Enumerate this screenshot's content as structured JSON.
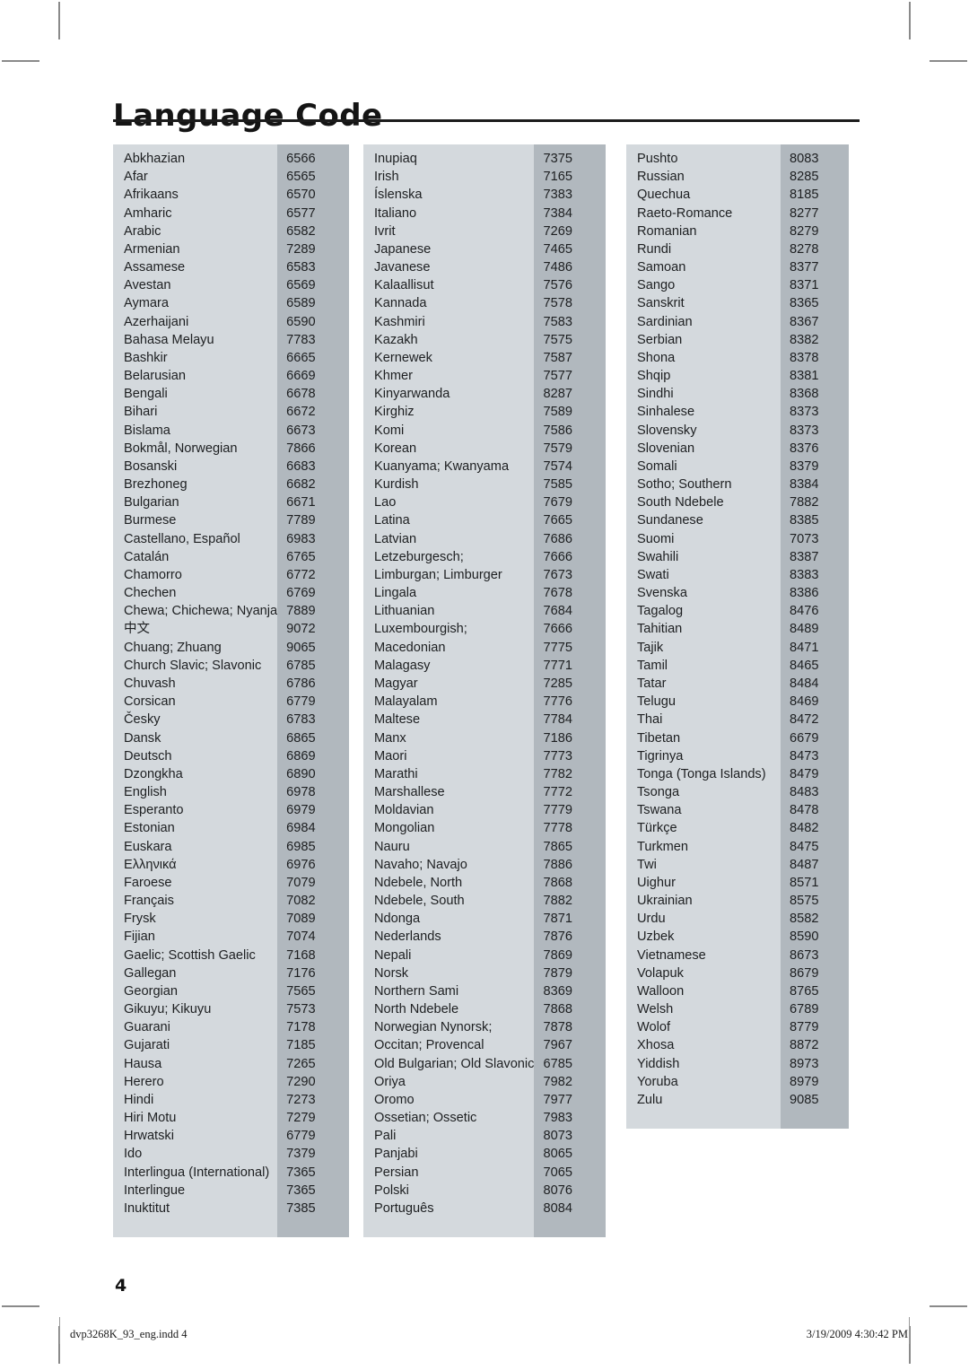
{
  "page": {
    "title": "Language Code",
    "page_number": "4"
  },
  "footer": {
    "file_name": "dvp3268K_93_eng.indd   4",
    "timestamp": "3/19/2009   4:30:42 PM"
  },
  "colors": {
    "name_band": "#d4d9dd",
    "code_band": "#b1b8be",
    "rule": "#1c1c1c",
    "text": "#1d1f21"
  },
  "columns": [
    {
      "id": "column-1",
      "rows": [
        {
          "name": "Abkhazian",
          "code": "6566"
        },
        {
          "name": "Afar",
          "code": "6565"
        },
        {
          "name": "Afrikaans",
          "code": "6570"
        },
        {
          "name": "Amharic",
          "code": "6577"
        },
        {
          "name": "Arabic",
          "code": "6582"
        },
        {
          "name": "Armenian",
          "code": "7289"
        },
        {
          "name": "Assamese",
          "code": "6583"
        },
        {
          "name": "Avestan",
          "code": "6569"
        },
        {
          "name": "Aymara",
          "code": "6589"
        },
        {
          "name": "Azerhaijani",
          "code": "6590"
        },
        {
          "name": "Bahasa Melayu",
          "code": "7783"
        },
        {
          "name": "Bashkir",
          "code": "6665"
        },
        {
          "name": "Belarusian",
          "code": "6669"
        },
        {
          "name": "Bengali",
          "code": "6678"
        },
        {
          "name": "Bihari",
          "code": "6672"
        },
        {
          "name": "Bislama",
          "code": "6673"
        },
        {
          "name": "Bokmål, Norwegian",
          "code": "7866"
        },
        {
          "name": "Bosanski",
          "code": "6683"
        },
        {
          "name": "Brezhoneg",
          "code": "6682"
        },
        {
          "name": "Bulgarian",
          "code": "6671"
        },
        {
          "name": "Burmese",
          "code": "7789"
        },
        {
          "name": "Castellano, Español",
          "code": "6983"
        },
        {
          "name": "Catalán",
          "code": "6765"
        },
        {
          "name": "Chamorro",
          "code": "6772"
        },
        {
          "name": "Chechen",
          "code": "6769"
        },
        {
          "name": "Chewa; Chichewa; Nyanja",
          "code": "7889"
        },
        {
          "name": "中文",
          "code": "9072",
          "cjk": true
        },
        {
          "name": "Chuang; Zhuang",
          "code": "9065"
        },
        {
          "name": "Church Slavic; Slavonic",
          "code": "6785"
        },
        {
          "name": "Chuvash",
          "code": "6786"
        },
        {
          "name": "Corsican",
          "code": "6779"
        },
        {
          "name": "Česky",
          "code": "6783"
        },
        {
          "name": "Dansk",
          "code": "6865"
        },
        {
          "name": "Deutsch",
          "code": "6869"
        },
        {
          "name": "Dzongkha",
          "code": "6890"
        },
        {
          "name": "English",
          "code": "6978"
        },
        {
          "name": "Esperanto",
          "code": "6979"
        },
        {
          "name": "Estonian",
          "code": "6984"
        },
        {
          "name": "Euskara",
          "code": "6985"
        },
        {
          "name": "Ελληνικά",
          "code": "6976"
        },
        {
          "name": "Faroese",
          "code": "7079"
        },
        {
          "name": "Français",
          "code": "7082"
        },
        {
          "name": "Frysk",
          "code": "7089"
        },
        {
          "name": "Fijian",
          "code": "7074"
        },
        {
          "name": "Gaelic; Scottish Gaelic",
          "code": "7168"
        },
        {
          "name": "Gallegan",
          "code": "7176"
        },
        {
          "name": "Georgian",
          "code": "7565"
        },
        {
          "name": "Gikuyu; Kikuyu",
          "code": "7573"
        },
        {
          "name": "Guarani",
          "code": "7178"
        },
        {
          "name": "Gujarati",
          "code": "7185"
        },
        {
          "name": "Hausa",
          "code": "7265"
        },
        {
          "name": "Herero",
          "code": "7290"
        },
        {
          "name": "Hindi",
          "code": "7273"
        },
        {
          "name": "Hiri Motu",
          "code": "7279"
        },
        {
          "name": "Hrwatski",
          "code": "6779"
        },
        {
          "name": "Ido",
          "code": "7379"
        },
        {
          "name": "Interlingua (International)",
          "code": "7365"
        },
        {
          "name": "Interlingue",
          "code": "7365"
        },
        {
          "name": "Inuktitut",
          "code": "7385"
        }
      ]
    },
    {
      "id": "column-2",
      "rows": [
        {
          "name": "Inupiaq",
          "code": "7375"
        },
        {
          "name": "Irish",
          "code": "7165"
        },
        {
          "name": "Íslenska",
          "code": "7383"
        },
        {
          "name": "Italiano",
          "code": "7384"
        },
        {
          "name": "Ivrit",
          "code": "7269"
        },
        {
          "name": "Japanese",
          "code": "7465"
        },
        {
          "name": "Javanese",
          "code": "7486"
        },
        {
          "name": "Kalaallisut",
          "code": "7576"
        },
        {
          "name": "Kannada",
          "code": "7578"
        },
        {
          "name": "Kashmiri",
          "code": "7583"
        },
        {
          "name": "Kazakh",
          "code": "7575"
        },
        {
          "name": "Kernewek",
          "code": "7587"
        },
        {
          "name": "Khmer",
          "code": "7577"
        },
        {
          "name": "Kinyarwanda",
          "code": "8287"
        },
        {
          "name": "Kirghiz",
          "code": "7589"
        },
        {
          "name": "Komi",
          "code": "7586"
        },
        {
          "name": "Korean",
          "code": "7579"
        },
        {
          "name": "Kuanyama; Kwanyama",
          "code": "7574"
        },
        {
          "name": "Kurdish",
          "code": "7585"
        },
        {
          "name": "Lao",
          "code": "7679"
        },
        {
          "name": "Latina",
          "code": "7665"
        },
        {
          "name": "Latvian",
          "code": "7686"
        },
        {
          "name": "Letzeburgesch;",
          "code": "7666"
        },
        {
          "name": "Limburgan; Limburger",
          "code": "7673"
        },
        {
          "name": "Lingala",
          "code": "7678"
        },
        {
          "name": "Lithuanian",
          "code": "7684"
        },
        {
          "name": "Luxembourgish;",
          "code": "7666"
        },
        {
          "name": "Macedonian",
          "code": "7775"
        },
        {
          "name": "Malagasy",
          "code": "7771"
        },
        {
          "name": "Magyar",
          "code": "7285"
        },
        {
          "name": "Malayalam",
          "code": "7776"
        },
        {
          "name": "Maltese",
          "code": "7784"
        },
        {
          "name": "Manx",
          "code": "7186"
        },
        {
          "name": "Maori",
          "code": "7773"
        },
        {
          "name": "Marathi",
          "code": "7782"
        },
        {
          "name": "Marshallese",
          "code": "7772"
        },
        {
          "name": "Moldavian",
          "code": "7779"
        },
        {
          "name": "Mongolian",
          "code": "7778"
        },
        {
          "name": "Nauru",
          "code": "7865"
        },
        {
          "name": "Navaho; Navajo",
          "code": "7886"
        },
        {
          "name": "Ndebele, North",
          "code": "7868"
        },
        {
          "name": "Ndebele, South",
          "code": "7882"
        },
        {
          "name": "Ndonga",
          "code": "7871"
        },
        {
          "name": "Nederlands",
          "code": "7876"
        },
        {
          "name": "Nepali",
          "code": "7869"
        },
        {
          "name": "Norsk",
          "code": "7879"
        },
        {
          "name": "Northern Sami",
          "code": "8369"
        },
        {
          "name": "North Ndebele",
          "code": "7868"
        },
        {
          "name": "Norwegian Nynorsk;",
          "code": "7878"
        },
        {
          "name": "Occitan; Provencal",
          "code": "7967"
        },
        {
          "name": "Old Bulgarian; Old Slavonic",
          "code": "6785"
        },
        {
          "name": "Oriya",
          "code": "7982"
        },
        {
          "name": "Oromo",
          "code": "7977"
        },
        {
          "name": "Ossetian; Ossetic",
          "code": "7983"
        },
        {
          "name": "Pali",
          "code": "8073"
        },
        {
          "name": "Panjabi",
          "code": "8065"
        },
        {
          "name": "Persian",
          "code": "7065"
        },
        {
          "name": "Polski",
          "code": "8076"
        },
        {
          "name": "Português",
          "code": "8084"
        }
      ]
    },
    {
      "id": "column-3",
      "rows": [
        {
          "name": "Pushto",
          "code": "8083"
        },
        {
          "name": "Russian",
          "code": "8285"
        },
        {
          "name": "Quechua",
          "code": "8185"
        },
        {
          "name": "Raeto-Romance",
          "code": "8277"
        },
        {
          "name": "Romanian",
          "code": "8279"
        },
        {
          "name": "Rundi",
          "code": "8278"
        },
        {
          "name": "Samoan",
          "code": "8377"
        },
        {
          "name": "Sango",
          "code": "8371"
        },
        {
          "name": "Sanskrit",
          "code": "8365"
        },
        {
          "name": "Sardinian",
          "code": "8367"
        },
        {
          "name": "Serbian",
          "code": "8382"
        },
        {
          "name": "Shona",
          "code": "8378"
        },
        {
          "name": "Shqip",
          "code": "8381"
        },
        {
          "name": "Sindhi",
          "code": "8368"
        },
        {
          "name": "Sinhalese",
          "code": "8373"
        },
        {
          "name": "Slovensky",
          "code": "8373"
        },
        {
          "name": "Slovenian",
          "code": "8376"
        },
        {
          "name": "Somali",
          "code": "8379"
        },
        {
          "name": "Sotho; Southern",
          "code": "8384"
        },
        {
          "name": "South Ndebele",
          "code": "7882"
        },
        {
          "name": "Sundanese",
          "code": "8385"
        },
        {
          "name": "Suomi",
          "code": "7073"
        },
        {
          "name": "Swahili",
          "code": "8387"
        },
        {
          "name": "Swati",
          "code": "8383"
        },
        {
          "name": "Svenska",
          "code": "8386"
        },
        {
          "name": "Tagalog",
          "code": "8476"
        },
        {
          "name": "Tahitian",
          "code": "8489"
        },
        {
          "name": "Tajik",
          "code": "8471"
        },
        {
          "name": "Tamil",
          "code": "8465"
        },
        {
          "name": "Tatar",
          "code": "8484"
        },
        {
          "name": "Telugu",
          "code": "8469"
        },
        {
          "name": "Thai",
          "code": "8472"
        },
        {
          "name": "Tibetan",
          "code": "6679"
        },
        {
          "name": "Tigrinya",
          "code": "8473"
        },
        {
          "name": "Tonga (Tonga Islands)",
          "code": "8479"
        },
        {
          "name": "Tsonga",
          "code": "8483"
        },
        {
          "name": "Tswana",
          "code": "8478"
        },
        {
          "name": "Türkçe",
          "code": "8482"
        },
        {
          "name": "Turkmen",
          "code": "8475"
        },
        {
          "name": "Twi",
          "code": "8487"
        },
        {
          "name": "Uighur",
          "code": "8571"
        },
        {
          "name": "Ukrainian",
          "code": "8575"
        },
        {
          "name": "Urdu",
          "code": "8582"
        },
        {
          "name": "Uzbek",
          "code": "8590"
        },
        {
          "name": "Vietnamese",
          "code": "8673"
        },
        {
          "name": "Volapuk",
          "code": "8679"
        },
        {
          "name": "Walloon",
          "code": "8765"
        },
        {
          "name": "Welsh",
          "code": "6789"
        },
        {
          "name": "Wolof",
          "code": "8779"
        },
        {
          "name": "Xhosa",
          "code": "8872"
        },
        {
          "name": "Yiddish",
          "code": "8973"
        },
        {
          "name": "Yoruba",
          "code": "8979"
        },
        {
          "name": "Zulu",
          "code": "9085"
        }
      ]
    }
  ]
}
